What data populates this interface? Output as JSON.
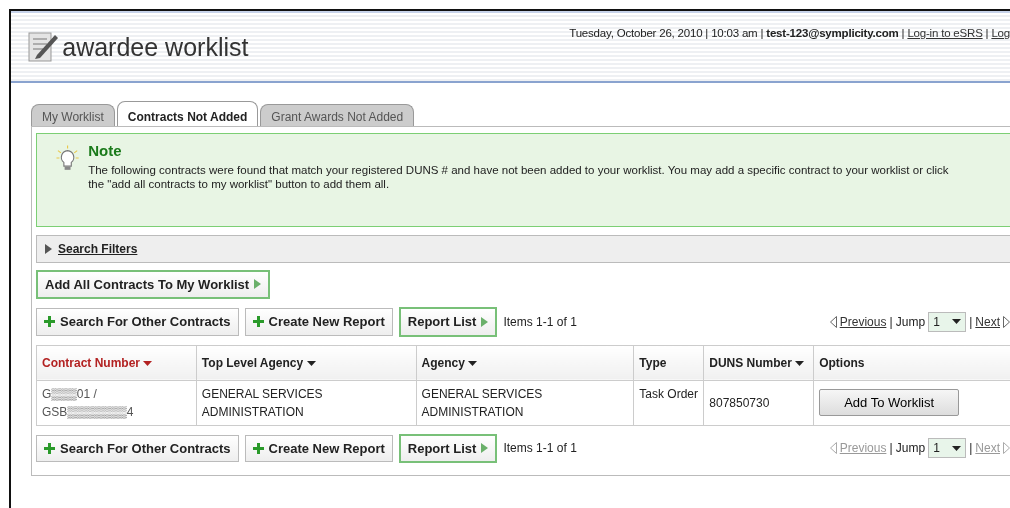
{
  "header": {
    "title": "awardee worklist",
    "date": "Tuesday, October 26, 2010 | 10:03 am |",
    "user": "test-123@symplicity.com",
    "separator": "|",
    "links": [
      "Log-in to eSRS",
      "Log"
    ]
  },
  "tabs": [
    {
      "label": "My Worklist",
      "selected": false
    },
    {
      "label": "Contracts Not Added",
      "selected": true
    },
    {
      "label": "Grant Awards Not Added",
      "selected": false
    }
  ],
  "note": {
    "title": "Note",
    "text": "The following contracts were found that match your registered DUNS # and have not been added to your worklist. You may add a specific contract to your worklist or click the \"add all contracts to my worklist\" button to add them all."
  },
  "search_filters": {
    "label": "Search Filters",
    "expanded": false
  },
  "add_all_button": "Add All Contracts To My Worklist",
  "toolbars": [
    {
      "buttons": [
        {
          "kind": "plus",
          "label": "Search For Other Contracts"
        },
        {
          "kind": "plus",
          "label": "Create New Report"
        },
        {
          "kind": "arrow",
          "label": "Report List"
        }
      ],
      "items": "Items 1-1 of 1",
      "previous": "Previous",
      "jump": "| Jump",
      "page": "1",
      "next": "Next",
      "nav_disabled": false
    },
    {
      "buttons": [
        {
          "kind": "plus",
          "label": "Search For Other Contracts"
        },
        {
          "kind": "plus",
          "label": "Create New Report"
        },
        {
          "kind": "arrow",
          "label": "Report List"
        }
      ],
      "items": "Items 1-1 of 1",
      "previous": "Previous",
      "jump": "| Jump",
      "page": "1",
      "next": "Next",
      "nav_disabled": true
    }
  ],
  "table": {
    "columns": [
      {
        "label": "Contract Number",
        "sortable": true,
        "selected": true
      },
      {
        "label": "Top Level Agency",
        "sortable": true,
        "selected": false
      },
      {
        "label": "Agency",
        "sortable": true,
        "selected": false
      },
      {
        "label": "Type",
        "sortable": false,
        "selected": false
      },
      {
        "label": "DUNS Number",
        "sortable": true,
        "selected": false
      },
      {
        "label": "Options",
        "sortable": false,
        "selected": false
      }
    ],
    "rows": [
      {
        "cells": [
          "G▒▒▒01 / GSB▒▒▒▒▒▒▒4",
          "GENERAL SERVICES ADMINISTRATION",
          "GENERAL SERVICES ADMINISTRATION",
          "Task Order",
          "807850730"
        ],
        "action": "Add To Worklist"
      }
    ]
  }
}
